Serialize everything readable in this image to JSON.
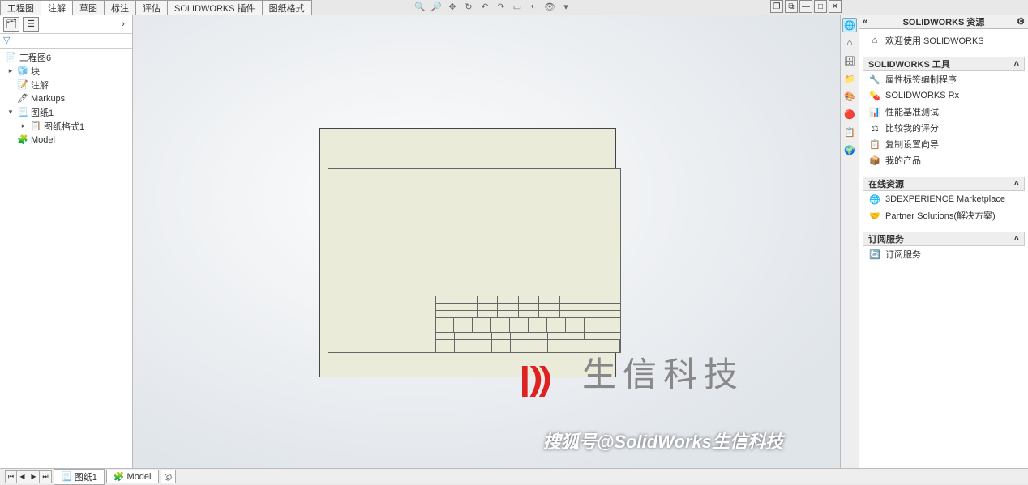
{
  "tabs": {
    "t1": "工程图",
    "t2": "注解",
    "t3": "草图",
    "t4": "标注",
    "t5": "评估",
    "t6": "SOLIDWORKS 插件",
    "t7": "图纸格式"
  },
  "tree": {
    "root": "工程图6",
    "n1": "块",
    "n2": "注解",
    "n3": "Markups",
    "n4": "图纸1",
    "n5": "图纸格式1",
    "n6": "Model"
  },
  "right": {
    "title": "SOLIDWORKS 资源",
    "welcome": "欢迎使用  SOLIDWORKS",
    "sec_tools": "SOLIDWORKS 工具",
    "tool1": "属性标签编制程序",
    "tool2": "SOLIDWORKS Rx",
    "tool3": "性能基准测试",
    "tool4": "比较我的评分",
    "tool5": "复制设置向导",
    "tool6": "我的产品",
    "sec_online": "在线资源",
    "ol1": "3DEXPERIENCE Marketplace",
    "ol2": "Partner Solutions(解决方案)",
    "sec_sub": "订阅服务",
    "sub1": "订阅服务"
  },
  "bottom": {
    "sheet": "图纸1",
    "model": "Model"
  },
  "watermarks": {
    "w1": "生信科技",
    "w2": "搜狐号@SolidWorks生信科技"
  }
}
